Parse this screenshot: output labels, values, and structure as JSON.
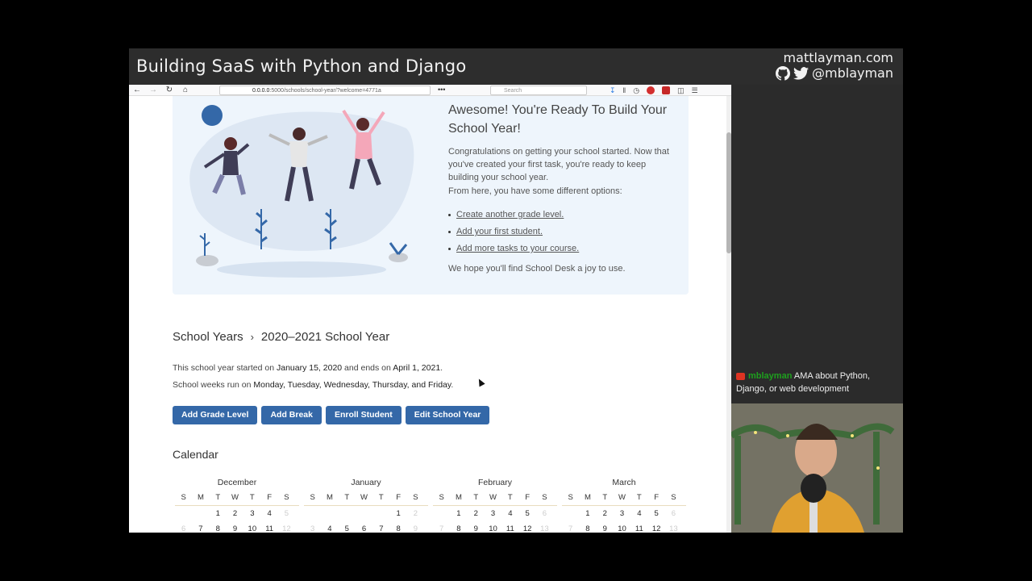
{
  "stream": {
    "title": "Building SaaS with Python and Django",
    "site": "mattlayman.com",
    "handle": "@mblayman"
  },
  "browser": {
    "url_host": "0.0.0.0",
    "url_rest": ":5000/schools/school-year/?welcome=4771a",
    "search_placeholder": "Search"
  },
  "welcome": {
    "title": "Awesome! You're Ready To Build Your School Year!",
    "p1": "Congratulations on getting your school started. Now that you've created your first task, you're ready to keep building your school year.",
    "p2": "From here, you have some different options:",
    "options": [
      "Create another grade level.",
      "Add your first student.",
      "Add more tasks to your course."
    ],
    "p3": "We hope you'll find School Desk a joy to use."
  },
  "breadcrumb": {
    "parent": "School Years",
    "current": "2020–2021 School Year"
  },
  "info": {
    "started_pre": "This school year started on ",
    "start_date": "January 15, 2020",
    "ends_mid": " and ends on ",
    "end_date": "April 1, 2021",
    "period": ".",
    "weeks_pre": "School weeks run on ",
    "week_days": "Monday, Tuesday, Wednesday, Thursday, and Friday",
    "weeks_post": "."
  },
  "actions": {
    "add_grade": "Add Grade Level",
    "add_break": "Add Break",
    "enroll": "Enroll Student",
    "edit": "Edit School Year"
  },
  "calendar": {
    "title": "Calendar",
    "dow": [
      "S",
      "M",
      "T",
      "W",
      "T",
      "F",
      "S"
    ],
    "months": [
      {
        "name": "December",
        "weeks": [
          [
            "",
            "",
            "1",
            "2",
            "3",
            "4",
            "5"
          ],
          [
            "6",
            "7",
            "8",
            "9",
            "10",
            "11",
            "12"
          ]
        ]
      },
      {
        "name": "January",
        "weeks": [
          [
            "",
            "",
            "",
            "",
            "",
            "1",
            "2"
          ],
          [
            "3",
            "4",
            "5",
            "6",
            "7",
            "8",
            "9"
          ]
        ]
      },
      {
        "name": "February",
        "weeks": [
          [
            "",
            "1",
            "2",
            "3",
            "4",
            "5",
            "6"
          ],
          [
            "7",
            "8",
            "9",
            "10",
            "11",
            "12",
            "13"
          ]
        ]
      },
      {
        "name": "March",
        "weeks": [
          [
            "",
            "1",
            "2",
            "3",
            "4",
            "5",
            "6"
          ],
          [
            "7",
            "8",
            "9",
            "10",
            "11",
            "12",
            "13"
          ]
        ]
      }
    ]
  },
  "chat": {
    "user": "mblayman",
    "message": "AMA about Python, Django, or web development"
  }
}
